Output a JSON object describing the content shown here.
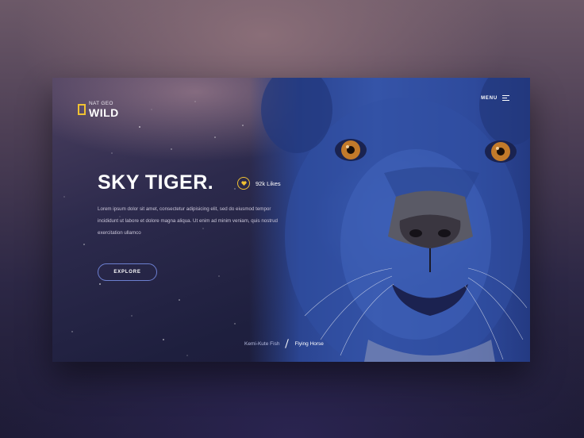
{
  "brand": {
    "logo_small": "NAT GEO",
    "logo_big": "WILD",
    "accent_color": "#f1c232"
  },
  "menu": {
    "label": "MENU",
    "icon": "hamburger-icon"
  },
  "hero": {
    "title": "SKY TIGER.",
    "likes_icon": "heart-icon",
    "likes": "92k Likes",
    "description": "Lorem ipsum dolor sit amet, consectetur adipisicing elit, sed do eiusmod tempor incididunt ut labore et dolore magna aliqua. Ut enim ad minim veniam, quis nostrud exercitation ullamco",
    "cta": "EXPLORE"
  },
  "pager": {
    "prev": "Kemi-Kute Fish",
    "next": "Flying Horse"
  }
}
